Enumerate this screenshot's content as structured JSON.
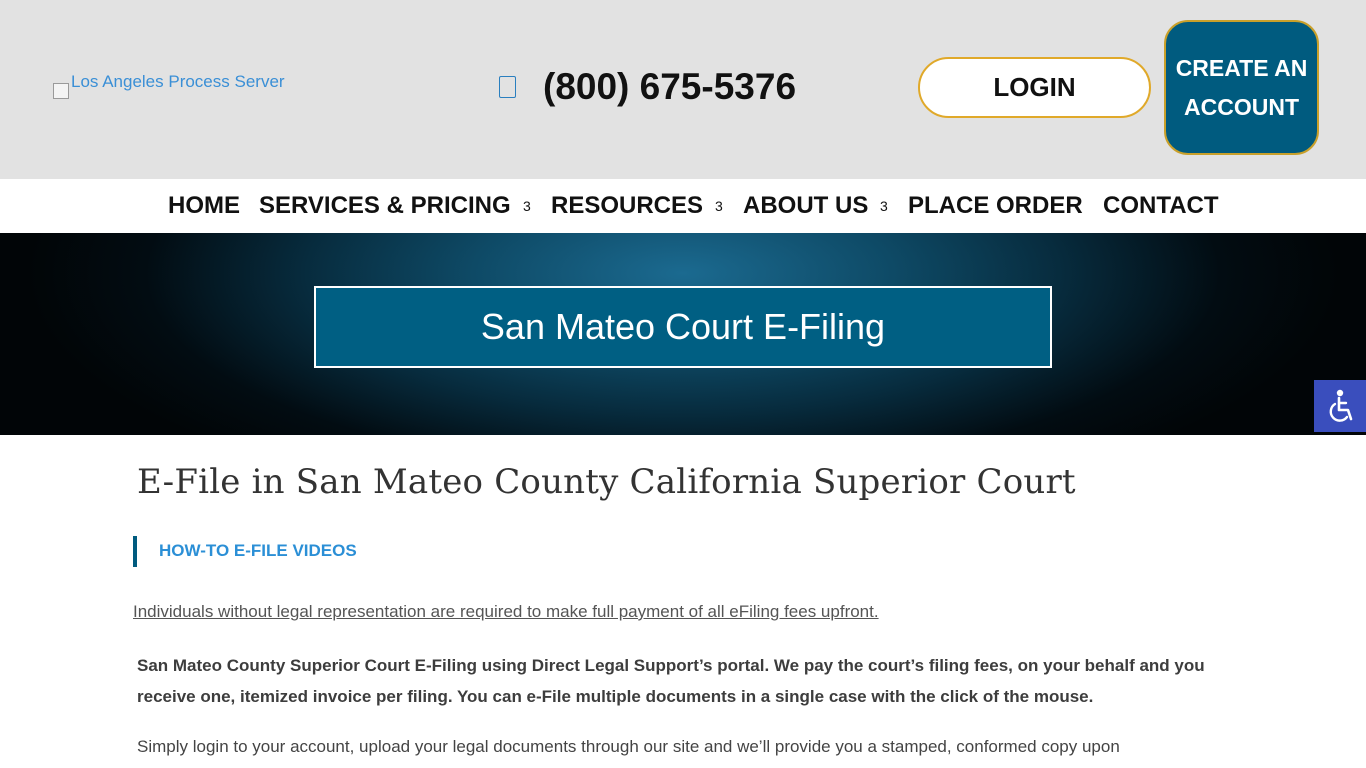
{
  "header": {
    "logo_alt": "Los Angeles Process Server",
    "phone": "(800) 675-5376",
    "login_label": "LOGIN",
    "create_account_label": "CREATE AN ACCOUNT"
  },
  "nav": {
    "items": [
      {
        "label": "HOME",
        "has_submenu": false
      },
      {
        "label": "SERVICES & PRICING",
        "has_submenu": true
      },
      {
        "label": "RESOURCES",
        "has_submenu": true
      },
      {
        "label": "ABOUT US",
        "has_submenu": true
      },
      {
        "label": "PLACE ORDER",
        "has_submenu": false
      },
      {
        "label": "CONTACT",
        "has_submenu": false
      }
    ],
    "submenu_glyph": "3"
  },
  "hero": {
    "title": "San Mateo Court E-Filing"
  },
  "main": {
    "heading": "E-File in San Mateo County California Superior Court",
    "section_link": "HOW-TO E-FILE VIDEOS",
    "notice": "Individuals without legal representation are required to make full payment of all eFiling fees upfront.",
    "intro": "San Mateo County Superior Court E-Filing using Direct Legal Support’s portal. We pay the court’s filing fees, on your behalf and you receive one, itemized invoice per filing. You can e-File multiple documents in a single case with the click of the mouse.",
    "body": "Simply login to your account, upload your legal documents through our site and we’ll provide you a stamped, conformed copy upon"
  },
  "accessibility": {
    "icon": "wheelchair-icon"
  },
  "colors": {
    "topbar_bg": "#e2e2e2",
    "brand_blue": "#005b7f",
    "accent_gold": "#e0a92a",
    "link_blue": "#2b8fd6",
    "a11y_bg": "#3a4ebd"
  }
}
